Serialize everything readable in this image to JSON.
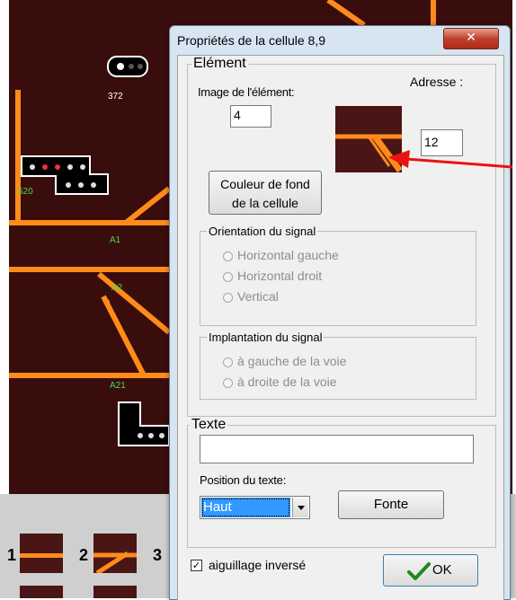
{
  "canvas": {
    "labels": [
      "372",
      "520",
      "A1",
      "A2",
      "A21"
    ],
    "colors": {
      "background": "#3a0d0d",
      "track": "#ff8c1a",
      "label": "#44dd44",
      "red_arrow": "#ee1111"
    }
  },
  "palette": {
    "numbers": [
      "1",
      "2",
      "3"
    ]
  },
  "dialog": {
    "title": "Propriétés de la cellule 8,9",
    "close_symbol": "✕",
    "element": {
      "legend": "Elément",
      "image_label": "Image de l'élément:",
      "image_value": "4",
      "address_label": "Adresse :",
      "address_value": "12",
      "bg_color_button": [
        "Couleur de fond",
        "de la cellule"
      ]
    },
    "orientation": {
      "legend": "Orientation du signal",
      "options": [
        "Horizontal gauche",
        "Horizontal droit",
        "Vertical"
      ]
    },
    "implantation": {
      "legend": "Implantation du signal",
      "options": [
        "à gauche de la voie",
        "à droite de la voie"
      ]
    },
    "text": {
      "legend": "Texte",
      "value": "",
      "position_label": "Position du texte:",
      "position_value": "Haut",
      "font_button": "Fonte"
    },
    "inverted_switch": {
      "label": "aiguillage inversé",
      "checked": true,
      "check_mark": "✓"
    },
    "ok_button": {
      "label": "OK",
      "icon": "check-icon"
    }
  }
}
